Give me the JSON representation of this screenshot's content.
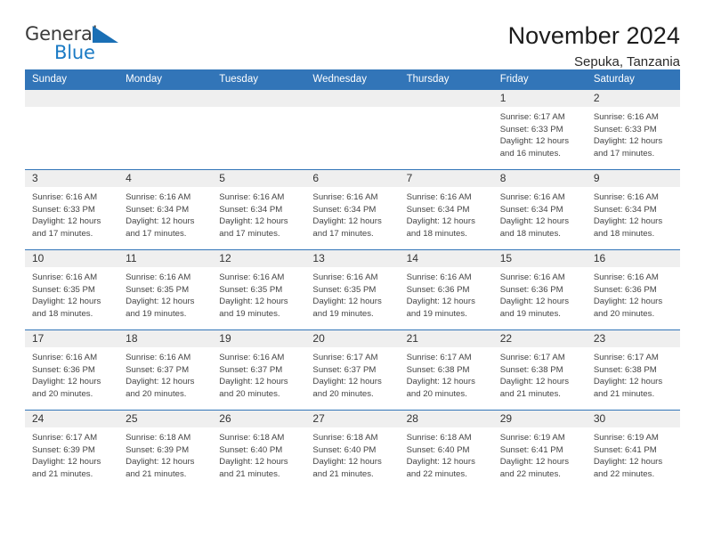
{
  "brand": {
    "word_one": "General",
    "word_two": "Blue",
    "icon": "triangle-wedge-icon"
  },
  "header": {
    "title": "November 2024",
    "subtitle": "Sepuka, Tanzania"
  },
  "colors": {
    "header_blue": "#3275b8",
    "brand_blue": "#1a7ac4",
    "daynum_band": "#efefef",
    "text": "#444444"
  },
  "weekday_headers": [
    "Sunday",
    "Monday",
    "Tuesday",
    "Wednesday",
    "Thursday",
    "Friday",
    "Saturday"
  ],
  "labels": {
    "sunrise_prefix": "Sunrise:",
    "sunset_prefix": "Sunset:",
    "daylight_prefix": "Daylight:"
  },
  "weeks": [
    [
      {
        "day": "",
        "empty": true
      },
      {
        "day": "",
        "empty": true
      },
      {
        "day": "",
        "empty": true
      },
      {
        "day": "",
        "empty": true
      },
      {
        "day": "",
        "empty": true
      },
      {
        "day": "1",
        "sunrise": "Sunrise: 6:17 AM",
        "sunset": "Sunset: 6:33 PM",
        "daylight_line1": "Daylight: 12 hours",
        "daylight_line2": "and 16 minutes."
      },
      {
        "day": "2",
        "sunrise": "Sunrise: 6:16 AM",
        "sunset": "Sunset: 6:33 PM",
        "daylight_line1": "Daylight: 12 hours",
        "daylight_line2": "and 17 minutes."
      }
    ],
    [
      {
        "day": "3",
        "sunrise": "Sunrise: 6:16 AM",
        "sunset": "Sunset: 6:33 PM",
        "daylight_line1": "Daylight: 12 hours",
        "daylight_line2": "and 17 minutes."
      },
      {
        "day": "4",
        "sunrise": "Sunrise: 6:16 AM",
        "sunset": "Sunset: 6:34 PM",
        "daylight_line1": "Daylight: 12 hours",
        "daylight_line2": "and 17 minutes."
      },
      {
        "day": "5",
        "sunrise": "Sunrise: 6:16 AM",
        "sunset": "Sunset: 6:34 PM",
        "daylight_line1": "Daylight: 12 hours",
        "daylight_line2": "and 17 minutes."
      },
      {
        "day": "6",
        "sunrise": "Sunrise: 6:16 AM",
        "sunset": "Sunset: 6:34 PM",
        "daylight_line1": "Daylight: 12 hours",
        "daylight_line2": "and 17 minutes."
      },
      {
        "day": "7",
        "sunrise": "Sunrise: 6:16 AM",
        "sunset": "Sunset: 6:34 PM",
        "daylight_line1": "Daylight: 12 hours",
        "daylight_line2": "and 18 minutes."
      },
      {
        "day": "8",
        "sunrise": "Sunrise: 6:16 AM",
        "sunset": "Sunset: 6:34 PM",
        "daylight_line1": "Daylight: 12 hours",
        "daylight_line2": "and 18 minutes."
      },
      {
        "day": "9",
        "sunrise": "Sunrise: 6:16 AM",
        "sunset": "Sunset: 6:34 PM",
        "daylight_line1": "Daylight: 12 hours",
        "daylight_line2": "and 18 minutes."
      }
    ],
    [
      {
        "day": "10",
        "sunrise": "Sunrise: 6:16 AM",
        "sunset": "Sunset: 6:35 PM",
        "daylight_line1": "Daylight: 12 hours",
        "daylight_line2": "and 18 minutes."
      },
      {
        "day": "11",
        "sunrise": "Sunrise: 6:16 AM",
        "sunset": "Sunset: 6:35 PM",
        "daylight_line1": "Daylight: 12 hours",
        "daylight_line2": "and 19 minutes."
      },
      {
        "day": "12",
        "sunrise": "Sunrise: 6:16 AM",
        "sunset": "Sunset: 6:35 PM",
        "daylight_line1": "Daylight: 12 hours",
        "daylight_line2": "and 19 minutes."
      },
      {
        "day": "13",
        "sunrise": "Sunrise: 6:16 AM",
        "sunset": "Sunset: 6:35 PM",
        "daylight_line1": "Daylight: 12 hours",
        "daylight_line2": "and 19 minutes."
      },
      {
        "day": "14",
        "sunrise": "Sunrise: 6:16 AM",
        "sunset": "Sunset: 6:36 PM",
        "daylight_line1": "Daylight: 12 hours",
        "daylight_line2": "and 19 minutes."
      },
      {
        "day": "15",
        "sunrise": "Sunrise: 6:16 AM",
        "sunset": "Sunset: 6:36 PM",
        "daylight_line1": "Daylight: 12 hours",
        "daylight_line2": "and 19 minutes."
      },
      {
        "day": "16",
        "sunrise": "Sunrise: 6:16 AM",
        "sunset": "Sunset: 6:36 PM",
        "daylight_line1": "Daylight: 12 hours",
        "daylight_line2": "and 20 minutes."
      }
    ],
    [
      {
        "day": "17",
        "sunrise": "Sunrise: 6:16 AM",
        "sunset": "Sunset: 6:36 PM",
        "daylight_line1": "Daylight: 12 hours",
        "daylight_line2": "and 20 minutes."
      },
      {
        "day": "18",
        "sunrise": "Sunrise: 6:16 AM",
        "sunset": "Sunset: 6:37 PM",
        "daylight_line1": "Daylight: 12 hours",
        "daylight_line2": "and 20 minutes."
      },
      {
        "day": "19",
        "sunrise": "Sunrise: 6:16 AM",
        "sunset": "Sunset: 6:37 PM",
        "daylight_line1": "Daylight: 12 hours",
        "daylight_line2": "and 20 minutes."
      },
      {
        "day": "20",
        "sunrise": "Sunrise: 6:17 AM",
        "sunset": "Sunset: 6:37 PM",
        "daylight_line1": "Daylight: 12 hours",
        "daylight_line2": "and 20 minutes."
      },
      {
        "day": "21",
        "sunrise": "Sunrise: 6:17 AM",
        "sunset": "Sunset: 6:38 PM",
        "daylight_line1": "Daylight: 12 hours",
        "daylight_line2": "and 20 minutes."
      },
      {
        "day": "22",
        "sunrise": "Sunrise: 6:17 AM",
        "sunset": "Sunset: 6:38 PM",
        "daylight_line1": "Daylight: 12 hours",
        "daylight_line2": "and 21 minutes."
      },
      {
        "day": "23",
        "sunrise": "Sunrise: 6:17 AM",
        "sunset": "Sunset: 6:38 PM",
        "daylight_line1": "Daylight: 12 hours",
        "daylight_line2": "and 21 minutes."
      }
    ],
    [
      {
        "day": "24",
        "sunrise": "Sunrise: 6:17 AM",
        "sunset": "Sunset: 6:39 PM",
        "daylight_line1": "Daylight: 12 hours",
        "daylight_line2": "and 21 minutes."
      },
      {
        "day": "25",
        "sunrise": "Sunrise: 6:18 AM",
        "sunset": "Sunset: 6:39 PM",
        "daylight_line1": "Daylight: 12 hours",
        "daylight_line2": "and 21 minutes."
      },
      {
        "day": "26",
        "sunrise": "Sunrise: 6:18 AM",
        "sunset": "Sunset: 6:40 PM",
        "daylight_line1": "Daylight: 12 hours",
        "daylight_line2": "and 21 minutes."
      },
      {
        "day": "27",
        "sunrise": "Sunrise: 6:18 AM",
        "sunset": "Sunset: 6:40 PM",
        "daylight_line1": "Daylight: 12 hours",
        "daylight_line2": "and 21 minutes."
      },
      {
        "day": "28",
        "sunrise": "Sunrise: 6:18 AM",
        "sunset": "Sunset: 6:40 PM",
        "daylight_line1": "Daylight: 12 hours",
        "daylight_line2": "and 22 minutes."
      },
      {
        "day": "29",
        "sunrise": "Sunrise: 6:19 AM",
        "sunset": "Sunset: 6:41 PM",
        "daylight_line1": "Daylight: 12 hours",
        "daylight_line2": "and 22 minutes."
      },
      {
        "day": "30",
        "sunrise": "Sunrise: 6:19 AM",
        "sunset": "Sunset: 6:41 PM",
        "daylight_line1": "Daylight: 12 hours",
        "daylight_line2": "and 22 minutes."
      }
    ]
  ]
}
